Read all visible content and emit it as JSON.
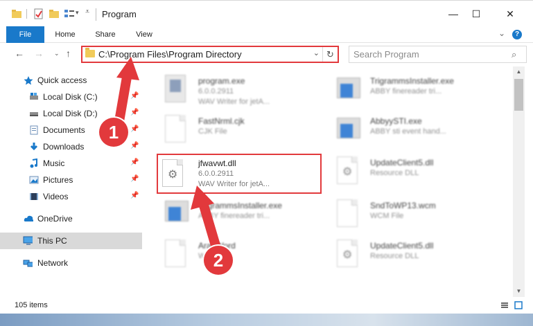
{
  "window": {
    "title": "Program",
    "minimize": "—",
    "maximize": "☐",
    "close": "✕"
  },
  "ribbon": {
    "tabs": [
      "File",
      "Home",
      "Share",
      "View"
    ],
    "help": "?"
  },
  "address": {
    "path": "C:\\Program Files\\Program Directory",
    "search_placeholder": "Search Program"
  },
  "nav": {
    "items": [
      {
        "label": "Quick access",
        "icon": "star-icon"
      },
      {
        "label": "Local Disk (C:)",
        "icon": "drive-icon",
        "pinned": true
      },
      {
        "label": "Local Disk (D:)",
        "icon": "drive-icon",
        "pinned": true
      },
      {
        "label": "Documents",
        "icon": "documents-icon",
        "pinned": true
      },
      {
        "label": "Downloads",
        "icon": "download-icon",
        "pinned": true
      },
      {
        "label": "Music",
        "icon": "music-icon",
        "pinned": true
      },
      {
        "label": "Pictures",
        "icon": "pictures-icon",
        "pinned": true
      },
      {
        "label": "Videos",
        "icon": "videos-icon",
        "pinned": true
      },
      {
        "label": "OneDrive",
        "icon": "cloud-icon"
      },
      {
        "label": "This PC",
        "icon": "computer-icon",
        "selected": true
      },
      {
        "label": "Network",
        "icon": "network-icon"
      }
    ]
  },
  "files": [
    {
      "name": "program.exe",
      "line2": "6.0.0.2911",
      "line3": "WAV Writer for jetA...",
      "icon": "app-icon"
    },
    {
      "name": "TrigrammsInstaller.exe",
      "line2": "ABBY finereader tri...",
      "line3": "",
      "icon": "app-icon"
    },
    {
      "name": "FastNrml.cjk",
      "line2": "CJK File",
      "line3": "",
      "icon": "document-icon"
    },
    {
      "name": "AbbyySTI.exe",
      "line2": "ABBY sti event hand...",
      "line3": "",
      "icon": "app-icon"
    },
    {
      "name": "jfwavwt.dll",
      "line2": "6.0.0.2911",
      "line3": "WAV Writer for jetA...",
      "icon": "dll-gear-icon"
    },
    {
      "name": "UpdateClient5.dll",
      "line2": "Resource DLL",
      "line3": "",
      "icon": "dll-gear-icon"
    },
    {
      "name": "TrigrammsInstaller.exe",
      "line2": "ABBY finereader tri...",
      "line3": "",
      "icon": "app-icon"
    },
    {
      "name": "SndToWP13.wcm",
      "line2": "WCM File",
      "line3": "",
      "icon": "document-icon"
    },
    {
      "name": "ArabWord",
      "line2": "WRD File",
      "line3": "",
      "icon": "document-icon"
    },
    {
      "name": "UpdateClient5.dll",
      "line2": "Resource DLL",
      "line3": "",
      "icon": "dll-gear-icon"
    }
  ],
  "status": {
    "count": "105 items"
  },
  "callouts": [
    "1",
    "2"
  ],
  "colors": {
    "accent": "#1979ca",
    "highlight": "#e2393c"
  }
}
